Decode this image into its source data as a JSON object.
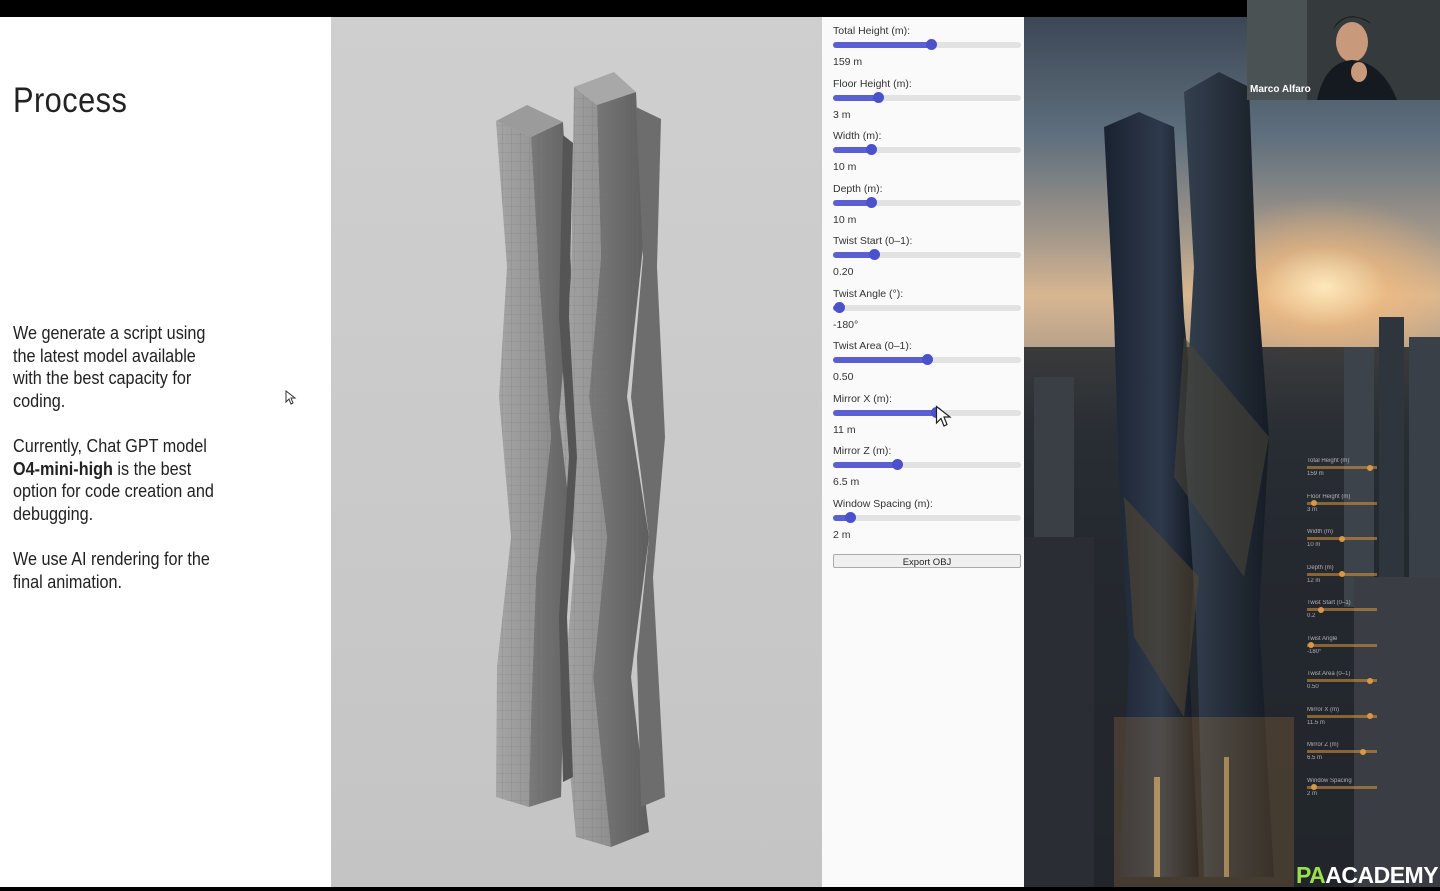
{
  "slide": {
    "title": "Process",
    "paragraph1": "We generate a script using the latest model available with the best capacity for coding.",
    "paragraph2_before": "Currently, Chat GPT model ",
    "paragraph2_bold": "O4-mini-high",
    "paragraph2_after": " is the best option for code creation and debugging.",
    "paragraph3": "We use AI rendering for the final animation."
  },
  "controls": [
    {
      "label": "Total Height (m):",
      "value": "159 m",
      "level": 0.52
    },
    {
      "label": "Floor Height (m):",
      "value": "3 m",
      "level": 0.24
    },
    {
      "label": "Width (m):",
      "value": "10 m",
      "level": 0.2
    },
    {
      "label": "Depth (m):",
      "value": "10 m",
      "level": 0.2
    },
    {
      "label": "Twist Start (0–1):",
      "value": "0.20",
      "level": 0.22
    },
    {
      "label": "Twist Angle (°):",
      "value": "-180°",
      "level": 0.03
    },
    {
      "label": "Twist Area (0–1):",
      "value": "0.50",
      "level": 0.5
    },
    {
      "label": "Mirror X (m):",
      "value": "11 m",
      "level": 0.55
    },
    {
      "label": "Mirror Z (m):",
      "value": "6.5 m",
      "level": 0.34
    },
    {
      "label": "Window Spacing (m):",
      "value": "2 m",
      "level": 0.09
    }
  ],
  "export_label": "Export OBJ",
  "render_overlay": [
    {
      "label": "Total Height (m)",
      "value": "159 m",
      "level": 0.9
    },
    {
      "label": "Floor Height (m)",
      "value": "3 m",
      "level": 0.1
    },
    {
      "label": "Width (m)",
      "value": "10 m",
      "level": 0.5
    },
    {
      "label": "Depth (m)",
      "value": "12 m",
      "level": 0.5
    },
    {
      "label": "Twist Start (0–1)",
      "value": "0.2",
      "level": 0.2
    },
    {
      "label": "Twist Angle",
      "value": "-180°",
      "level": 0.05
    },
    {
      "label": "Twist Area (0–1)",
      "value": "0.50",
      "level": 0.9
    },
    {
      "label": "Mirror X (m)",
      "value": "11.5 m",
      "level": 0.9
    },
    {
      "label": "Mirror Z (m)",
      "value": "6.5 m",
      "level": 0.8
    },
    {
      "label": "Window Spacing",
      "value": "2 m",
      "level": 0.1
    }
  ],
  "participant_name": "Marco Alfaro",
  "logo": {
    "part1": "PA",
    "part2": "ACADEMY"
  },
  "colors": {
    "slider_accent": "#4b51c9",
    "logo_accent": "#9be04a"
  }
}
